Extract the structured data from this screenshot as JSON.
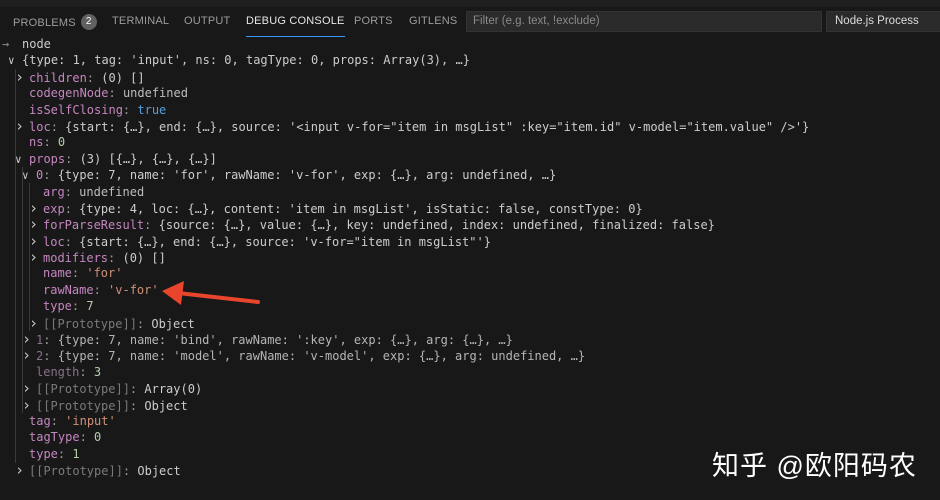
{
  "tabs": [
    {
      "label": "PROBLEMS",
      "badge": "2"
    },
    {
      "label": "TERMINAL"
    },
    {
      "label": "OUTPUT"
    },
    {
      "label": "DEBUG CONSOLE",
      "active": true
    },
    {
      "label": "PORTS"
    },
    {
      "label": "GITLENS"
    }
  ],
  "filter": {
    "placeholder": "Filter (e.g. text, !exclude)"
  },
  "session_select": {
    "value": "Node.js Process"
  },
  "console": {
    "input_echo": "node",
    "lines": [
      {
        "level": 0,
        "chev": "open",
        "key": "",
        "value": "{type: 1, tag: 'input', ns: 0, tagType: 0, props: Array(3), …}",
        "vclass": "plain"
      },
      {
        "level": 1,
        "chev": "closed",
        "key": "children",
        "value": "(0) []",
        "vclass": "plain"
      },
      {
        "level": 1,
        "chev": "",
        "key": "codegenNode",
        "value": "undefined",
        "vclass": "undef"
      },
      {
        "level": 1,
        "chev": "",
        "key": "isSelfClosing",
        "value": "true",
        "vclass": "bool"
      },
      {
        "level": 1,
        "chev": "closed",
        "key": "loc",
        "value": "{start: {…}, end: {…}, source: '<input v-for=\"item in msgList\" :key=\"item.id\" v-model=\"item.value\" />'}",
        "vclass": "plain"
      },
      {
        "level": 1,
        "chev": "",
        "key": "ns",
        "value": "0",
        "vclass": "num"
      },
      {
        "level": 1,
        "chev": "open",
        "key": "props",
        "value": "(3) [{…}, {…}, {…}]",
        "vclass": "plain"
      },
      {
        "level": 2,
        "chev": "open",
        "key": "0",
        "value": "{type: 7, name: 'for', rawName: 'v-for', exp: {…}, arg: undefined, …}",
        "vclass": "plain"
      },
      {
        "level": 3,
        "chev": "",
        "key": "arg",
        "value": "undefined",
        "vclass": "undef"
      },
      {
        "level": 3,
        "chev": "closed",
        "key": "exp",
        "value": "{type: 4, loc: {…}, content: 'item in msgList', isStatic: false, constType: 0}",
        "vclass": "plain"
      },
      {
        "level": 3,
        "chev": "closed",
        "key": "forParseResult",
        "value": "{source: {…}, value: {…}, key: undefined, index: undefined, finalized: false}",
        "vclass": "plain"
      },
      {
        "level": 3,
        "chev": "closed",
        "key": "loc",
        "value": "{start: {…}, end: {…}, source: 'v-for=\"item in msgList\"'}",
        "vclass": "plain"
      },
      {
        "level": 3,
        "chev": "closed",
        "key": "modifiers",
        "value": "(0) []",
        "vclass": "plain"
      },
      {
        "level": 3,
        "chev": "",
        "key": "name",
        "value": "'for'",
        "vclass": "str"
      },
      {
        "level": 3,
        "chev": "",
        "key": "rawName",
        "value": "'v-for'",
        "vclass": "str"
      },
      {
        "level": 3,
        "chev": "",
        "key": "type",
        "value": "7",
        "vclass": "num"
      },
      {
        "level": 3,
        "chev": "closed",
        "key": "[[Prototype]]",
        "value": "Object",
        "vclass": "plain",
        "proto": true
      },
      {
        "level": 2,
        "chev": "closed",
        "key": "1",
        "value": "{type: 7, name: 'bind', rawName: ':key', exp: {…}, arg: {…}, …}",
        "vclass": "plain",
        "dim": true
      },
      {
        "level": 2,
        "chev": "closed",
        "key": "2",
        "value": "{type: 7, name: 'model', rawName: 'v-model', exp: {…}, arg: undefined, …}",
        "vclass": "plain",
        "dim": true
      },
      {
        "level": 2,
        "chev": "",
        "key": "length",
        "value": "3",
        "vclass": "num",
        "dim": true
      },
      {
        "level": 2,
        "chev": "closed",
        "key": "[[Prototype]]",
        "value": "Array(0)",
        "vclass": "plain",
        "proto": true
      },
      {
        "level": 2,
        "chev": "closed",
        "key": "[[Prototype]]",
        "value": "Object",
        "vclass": "plain",
        "proto": true
      },
      {
        "level": 1,
        "chev": "",
        "key": "tag",
        "value": "'input'",
        "vclass": "str"
      },
      {
        "level": 1,
        "chev": "",
        "key": "tagType",
        "value": "0",
        "vclass": "num"
      },
      {
        "level": 1,
        "chev": "",
        "key": "type",
        "value": "1",
        "vclass": "num"
      },
      {
        "level": 1,
        "chev": "closed",
        "key": "[[Prototype]]",
        "value": "Object",
        "vclass": "plain",
        "proto": true
      }
    ]
  },
  "annotation": {
    "color": "#e8452c"
  },
  "watermark": "知乎 @欧阳码农"
}
